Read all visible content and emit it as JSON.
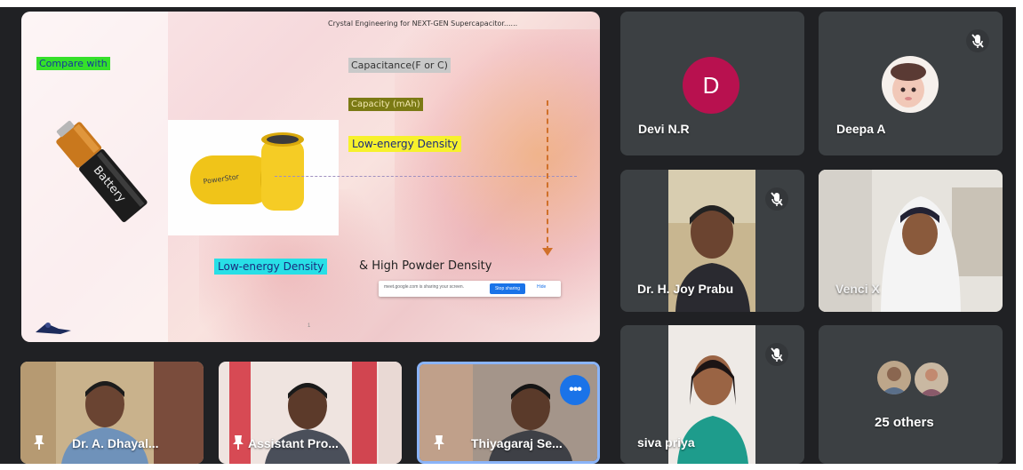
{
  "presentation": {
    "title": "Crystal Engineering for NEXT-GEN Supercapacitor......",
    "compare_label": "Compare with",
    "battery_label": "Battery",
    "cell_label": "PowerStor",
    "capacitance": "Capacitance(F or C)",
    "capacity": "Capacity (mAh)",
    "low_energy_top": "Low-energy Density",
    "low_energy_bottom": "Low-energy Density",
    "bottom_rest": "& High Powder Density",
    "popup": {
      "message": "meet.google.com is sharing your screen.",
      "stop_button": "Stop sharing",
      "hide_button": "Hide"
    },
    "page_dot": "1"
  },
  "participants": [
    {
      "name": "Devi N.R",
      "avatar_letter": "D",
      "avatar_color": "#b8114f"
    },
    {
      "name": "Deepa A",
      "muted": true
    },
    {
      "name": "Dr. H. Joy Prabu",
      "muted": true
    },
    {
      "name": "Venci X"
    },
    {
      "name": "siva priya",
      "muted": true
    },
    {
      "name": "25 others"
    }
  ],
  "filmstrip": [
    {
      "name": "Dr. A. Dhayal...",
      "pinned": true
    },
    {
      "name": "Assistant Pro...",
      "pinned": true
    },
    {
      "name": "Thiyagaraj Se...",
      "pinned": true,
      "active": true
    }
  ],
  "colors": {
    "background": "#202124",
    "tile": "#3c4043",
    "accent": "#1a73e8",
    "highlight_green": "#35e02a",
    "highlight_yellow": "#f7f12c",
    "highlight_cyan": "#28dfe6"
  },
  "icons": [
    "mic-off-icon",
    "pin-icon",
    "more-options-icon"
  ]
}
